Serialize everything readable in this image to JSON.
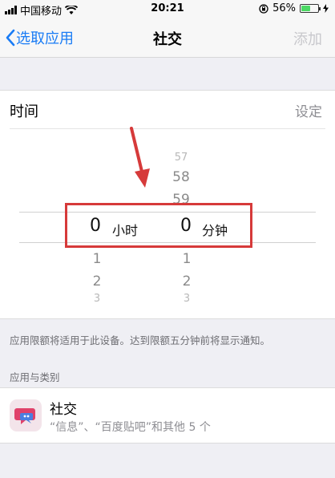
{
  "status_bar": {
    "carrier": "中国移动",
    "time": "20:21",
    "battery_percent": "56%",
    "battery_level": 0.56
  },
  "nav": {
    "back_label": "选取应用",
    "title": "社交",
    "add_label": "添加"
  },
  "time_section": {
    "label": "时间",
    "setting_label": "设定"
  },
  "picker": {
    "hours_above": [],
    "minutes_above": [
      "57",
      "58",
      "59"
    ],
    "hours_selected": "0",
    "hours_unit": "小时",
    "minutes_selected": "0",
    "minutes_unit": "分钟",
    "hours_below": [
      "1",
      "2",
      "3"
    ],
    "minutes_below": [
      "1",
      "2",
      "3"
    ]
  },
  "note": "应用限额将适用于此设备。达到限额五分钟前将显示通知。",
  "section_header": "应用与类别",
  "app_row": {
    "name": "社交",
    "subtitle": "“信息”、“百度贴吧”和其他 5 个",
    "icon": "chat-bubbles-icon"
  },
  "colors": {
    "accent": "#1a7cf5",
    "highlight_box": "#d63a3a",
    "battery": "#4cd964"
  }
}
